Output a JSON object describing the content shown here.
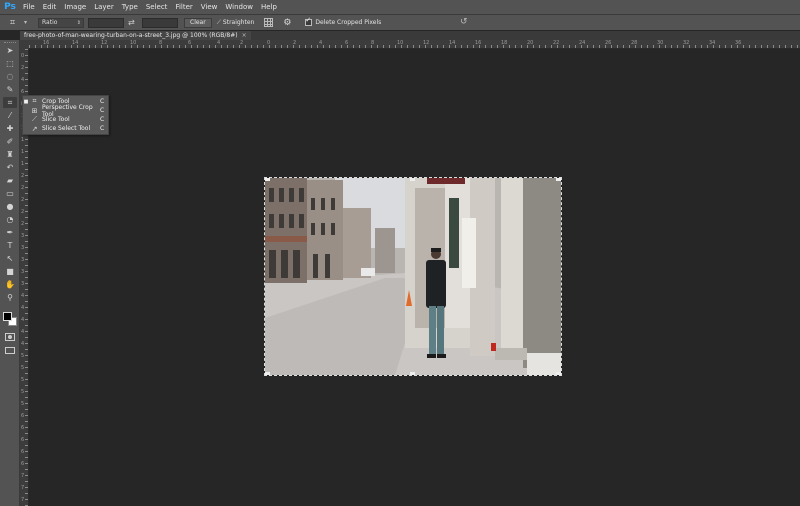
{
  "app": {
    "logo": "Ps"
  },
  "menu": [
    "File",
    "Edit",
    "Image",
    "Layer",
    "Type",
    "Select",
    "Filter",
    "View",
    "Window",
    "Help"
  ],
  "options": {
    "ratio_label": "Ratio",
    "clear_label": "Clear",
    "straighten_label": "Straighten",
    "delete_cropped_label": "Delete Cropped Pixels",
    "delete_cropped_checked": true
  },
  "document": {
    "tab_title": "free-photo-of-man-wearing-turban-on-a-street_3.jpg @ 100% (RGB/8#)",
    "close_glyph": "×"
  },
  "ruler": {
    "top_labels": [
      "16",
      "14",
      "12",
      "10",
      "8",
      "6",
      "4",
      "2",
      "0",
      "2",
      "4",
      "6",
      "8",
      "10",
      "12",
      "14",
      "16",
      "18",
      "20",
      "22",
      "24",
      "26",
      "28",
      "30",
      "32",
      "34",
      "36"
    ],
    "left_labels": [
      "0",
      "2",
      "4",
      "6",
      "8",
      "1",
      "1",
      "1",
      "1",
      "1",
      "2",
      "2",
      "2",
      "2",
      "2",
      "3",
      "3",
      "3",
      "3",
      "3",
      "4",
      "4",
      "4",
      "4",
      "4",
      "5",
      "5",
      "5",
      "5",
      "5",
      "6",
      "6",
      "6",
      "6",
      "6",
      "7",
      "7",
      "7"
    ]
  },
  "flyout": {
    "items": [
      {
        "label": "Crop Tool",
        "shortcut": "C",
        "icon": "crop-icon",
        "active": true
      },
      {
        "label": "Perspective Crop Tool",
        "shortcut": "C",
        "icon": "perspective-crop-icon",
        "active": false
      },
      {
        "label": "Slice Tool",
        "shortcut": "C",
        "icon": "slice-icon",
        "active": false
      },
      {
        "label": "Slice Select Tool",
        "shortcut": "C",
        "icon": "slice-select-icon",
        "active": false
      }
    ]
  },
  "colors": {
    "ps_blue": "#31a8ff",
    "panel": "#535353",
    "canvas": "#262626"
  }
}
